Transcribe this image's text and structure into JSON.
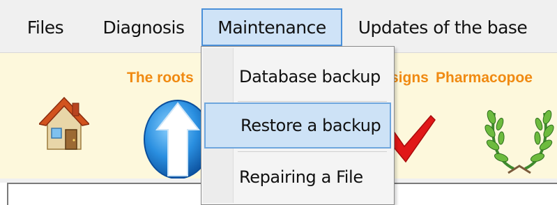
{
  "menubar": {
    "items": [
      {
        "label": "Files"
      },
      {
        "label": "Diagnosis"
      },
      {
        "label": "Maintenance",
        "state": "open"
      },
      {
        "label": "Updates of the base"
      }
    ]
  },
  "toolbar": {
    "labels": {
      "roots": "The roots",
      "signs": "signs",
      "pharmacopoeia": "Pharmacopoe"
    },
    "label_color": "#f08a12",
    "icons": [
      "home-icon",
      "up-arrow-icon",
      "checkmark-icon",
      "laurel-wreath-icon"
    ]
  },
  "maintenance_menu": {
    "items": [
      {
        "label": "Database backup"
      },
      {
        "label": "Restore a backup",
        "state": "hovered"
      },
      {
        "label": "Repairing a File"
      }
    ],
    "highlight_color": "#cde2f6"
  }
}
